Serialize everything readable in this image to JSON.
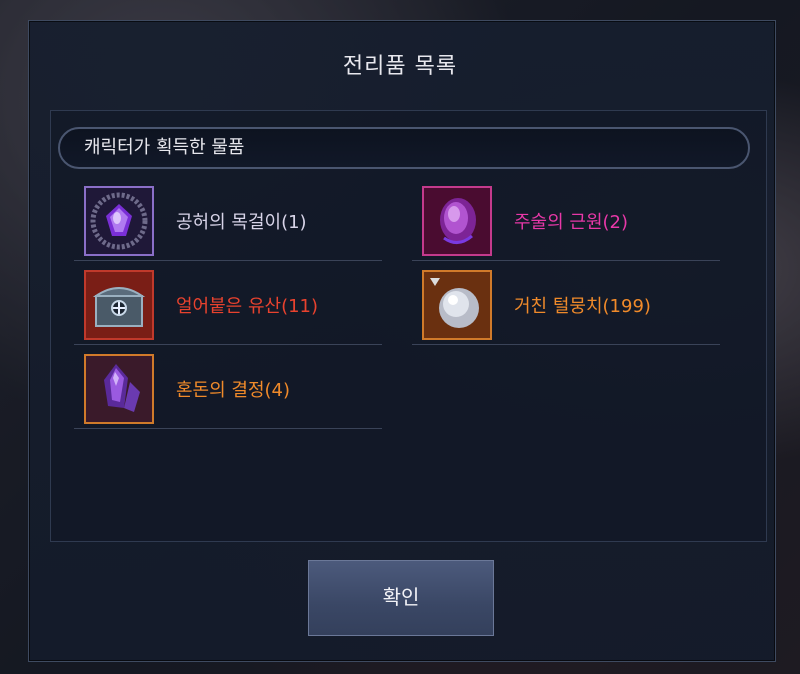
{
  "dialog": {
    "title": "전리품 목록",
    "section_header": "캐릭터가 획득한 물품",
    "confirm_label": "확인"
  },
  "items": [
    {
      "name": "공허의 목걸이(1)",
      "color": "#d8d4e8",
      "frame": "#8a6fc8",
      "icon": "purple-necklace-icon"
    },
    {
      "name": "주술의 근원(2)",
      "color": "#e838a8",
      "frame": "#c43a8c",
      "icon": "magenta-orb-icon"
    },
    {
      "name": "얼어붙은 유산(11)",
      "color": "#e8422e",
      "frame": "#c0392b",
      "icon": "frozen-chest-icon"
    },
    {
      "name": "거친 털뭉치(199)",
      "color": "#f08a2a",
      "frame": "#d07a2a",
      "icon": "fur-ball-icon"
    },
    {
      "name": "혼돈의 결정(4)",
      "color": "#f08a2a",
      "frame": "#d07a2a",
      "icon": "chaos-crystal-icon"
    }
  ]
}
